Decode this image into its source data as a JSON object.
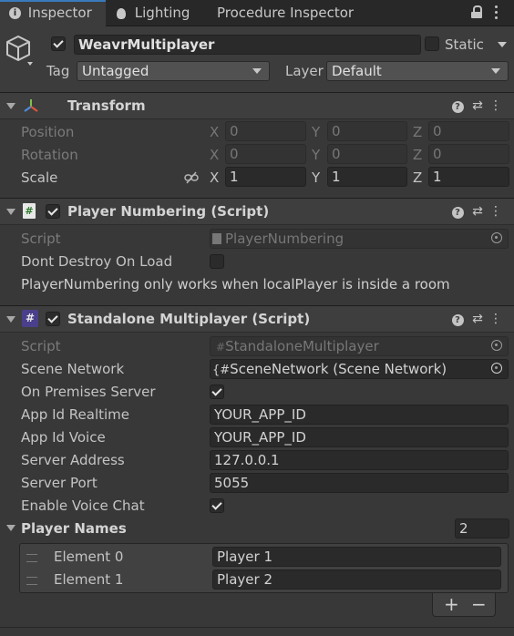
{
  "tabs": [
    {
      "label": "Inspector"
    },
    {
      "label": "Lighting"
    },
    {
      "label": "Procedure Inspector"
    }
  ],
  "gameobject": {
    "name": "WeavrMultiplayer",
    "static_label": "Static",
    "tag_label": "Tag",
    "tag_value": "Untagged",
    "layer_label": "Layer",
    "layer_value": "Default"
  },
  "transform": {
    "title": "Transform",
    "position_label": "Position",
    "rotation_label": "Rotation",
    "scale_label": "Scale",
    "axis_x": "X",
    "axis_y": "Y",
    "axis_z": "Z",
    "position": {
      "x": "0",
      "y": "0",
      "z": "0"
    },
    "rotation": {
      "x": "0",
      "y": "0",
      "z": "0"
    },
    "scale": {
      "x": "1",
      "y": "1",
      "z": "1"
    }
  },
  "player_numbering": {
    "title": "Player Numbering (Script)",
    "script_label": "Script",
    "script_value": "PlayerNumbering",
    "dont_destroy_label": "Dont Destroy On Load",
    "info": "PlayerNumbering only works when localPlayer is inside a room"
  },
  "standalone": {
    "title": "Standalone Multiplayer (Script)",
    "script_label": "Script",
    "script_value": "StandaloneMultiplayer",
    "scene_network_label": "Scene Network",
    "scene_network_value": "SceneNetwork (Scene Network)",
    "on_premises_label": "On Premises Server",
    "app_id_realtime_label": "App Id Realtime",
    "app_id_realtime_value": "YOUR_APP_ID",
    "app_id_voice_label": "App Id Voice",
    "app_id_voice_value": "YOUR_APP_ID",
    "server_address_label": "Server Address",
    "server_address_value": "127.0.0.1",
    "server_port_label": "Server Port",
    "server_port_value": "5055",
    "enable_voice_label": "Enable Voice Chat",
    "player_names_label": "Player Names",
    "player_names_count": "2",
    "elements": [
      {
        "label": "Element 0",
        "value": "Player 1"
      },
      {
        "label": "Element 1",
        "value": "Player 2"
      }
    ],
    "plus": "+",
    "minus": "−"
  }
}
